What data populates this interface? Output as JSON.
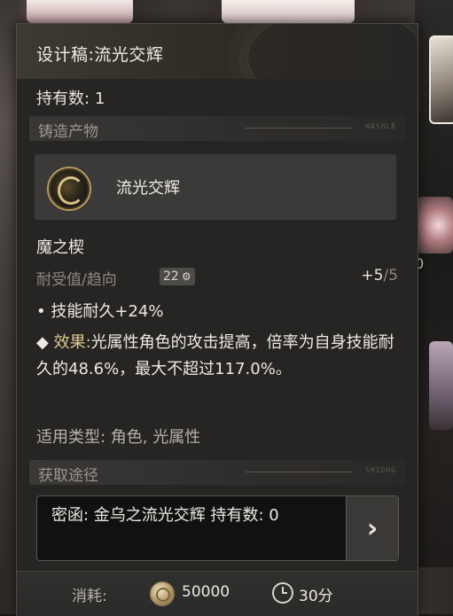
{
  "title": "设计稿:流光交辉",
  "owned": {
    "label": "持有数:",
    "value": "1"
  },
  "sections": {
    "product": {
      "label": "铸造产物",
      "deco": "WASHLB"
    },
    "route": {
      "label": "获取途径",
      "deco": "SHIDHG"
    }
  },
  "product": {
    "name": "流光交辉",
    "icon": "medal-icon"
  },
  "module": {
    "name": "魔之楔",
    "stat_label": "耐受值/趋向",
    "stat_badge": "22",
    "stat_value_current": "+5",
    "stat_value_max": "/5"
  },
  "bullet": "技能耐久+24%",
  "effect": {
    "prefix": "效果:",
    "text": "光属性角色的攻击提高，倍率为自身技能耐久的48.6%，最大不超过117.0%。"
  },
  "applicable": "适用类型: 角色, 光属性",
  "route": {
    "text": "密函: 金乌之流光交辉 持有数: 0",
    "arrow": "›"
  },
  "footer": {
    "cost_label": "消耗:",
    "cost_amount": "50000",
    "time": "30分"
  },
  "background": {
    "stray_text": "0"
  },
  "colors": {
    "accent_gold": "#e2c98f",
    "panel_bg": "#262524",
    "route_bg": "#111111"
  }
}
